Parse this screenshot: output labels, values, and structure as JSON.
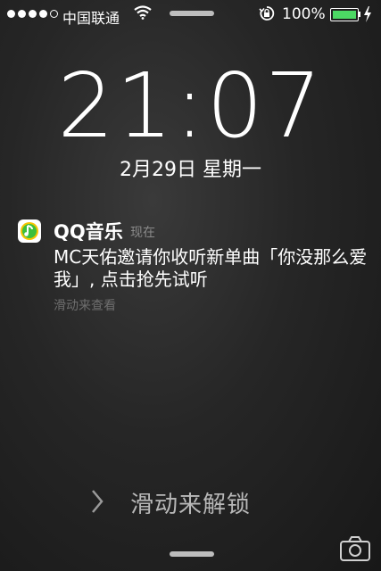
{
  "status_bar": {
    "signal_dots": 5,
    "signal_filled": 4,
    "carrier": "中国联通",
    "battery_percent": "100%",
    "battery_level": 1.0,
    "icons": [
      "wifi-icon",
      "rotation-lock-icon",
      "battery-icon",
      "charging-bolt-icon"
    ]
  },
  "lock_screen": {
    "time": "21:07",
    "date": "2月29日 星期一",
    "unlock_text": "滑动来解锁"
  },
  "notification": {
    "app_name": "QQ音乐",
    "time_label": "现在",
    "body": "MC天佑邀请你收听新单曲「你没那么爱我」, 点击抢先试听",
    "hint": "滑动来查看",
    "icon": "qq-music-icon"
  },
  "colors": {
    "battery_green": "#4cd964",
    "app_icon_bg": "#ffffff",
    "app_icon_accent": "#f5c400"
  }
}
